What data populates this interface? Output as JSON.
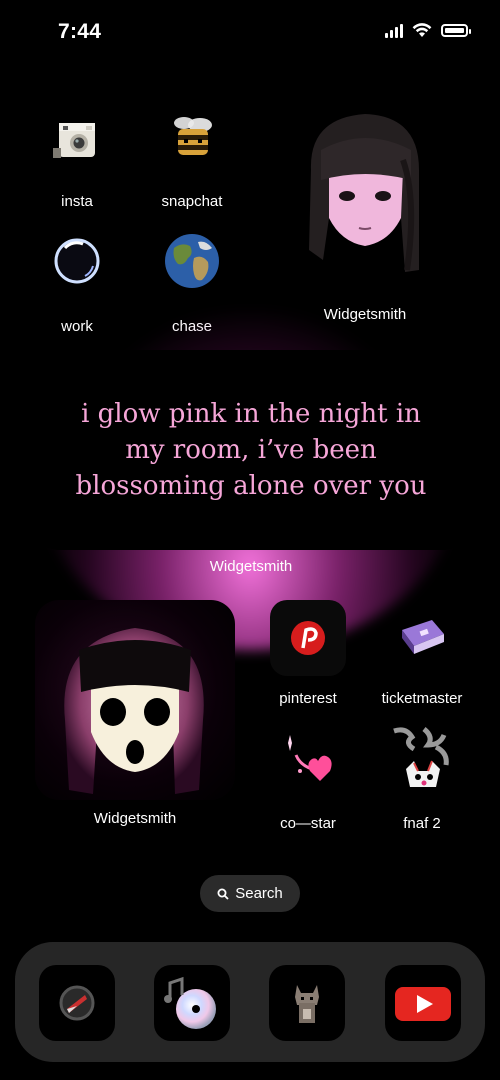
{
  "status_bar": {
    "time": "7:44"
  },
  "apps": {
    "insta": "insta",
    "snapchat": "snapchat",
    "work": "work",
    "chase": "chase",
    "pinterest": "pinterest",
    "ticketmaster": "ticketmaster",
    "costar": "co—star",
    "fnaf": "fnaf 2"
  },
  "widgets": {
    "top_caption": "Widgetsmith",
    "quote": "i glow pink in the night in my room, i’ve been blossoming alone over you",
    "quote_caption": "Widgetsmith",
    "bottom_caption": "Widgetsmith"
  },
  "search": {
    "label": "Search"
  },
  "dock": [
    "compass-icon",
    "music-cd-icon",
    "cat-icon",
    "youtube-icon"
  ],
  "colors": {
    "quote_text": "#f6a6d8",
    "glow": "#ff78e6",
    "dock": "#262626"
  }
}
